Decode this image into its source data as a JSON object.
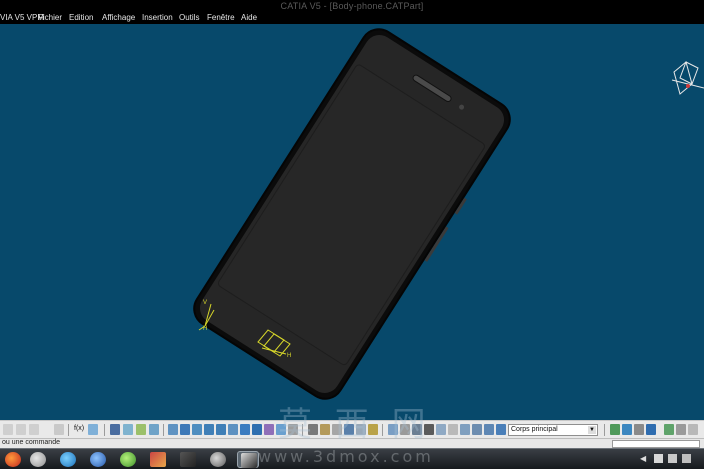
{
  "window": {
    "title": "CATIA V5 - [Body-phone.CATPart]",
    "app_label": "VIA V5 VPM"
  },
  "menu": {
    "items": [
      "Fichier",
      "Edition",
      "Affichage",
      "Insertion",
      "Outils",
      "Fenêtre",
      "Aide"
    ]
  },
  "viewport": {
    "background": "#07496b",
    "model_color": "#262626"
  },
  "toolbar": {
    "formula_label": "f(x)",
    "body_select": "Corps principal"
  },
  "status": {
    "command_hint": "ou une commande"
  },
  "taskbar": {
    "apps": [
      "firefox-icon",
      "catia-icon",
      "itunes-icon",
      "lightning-icon",
      "utorrent-icon",
      "photos-icon",
      "media-icon",
      "catia-v5-icon",
      "active-window"
    ]
  },
  "tray": {
    "icons": [
      "tray-arrow-icon",
      "flag-icon",
      "volume-icon",
      "network-icon"
    ]
  },
  "watermark": {
    "chinese": "莫 西 网",
    "url": "www.3dmox.com"
  }
}
